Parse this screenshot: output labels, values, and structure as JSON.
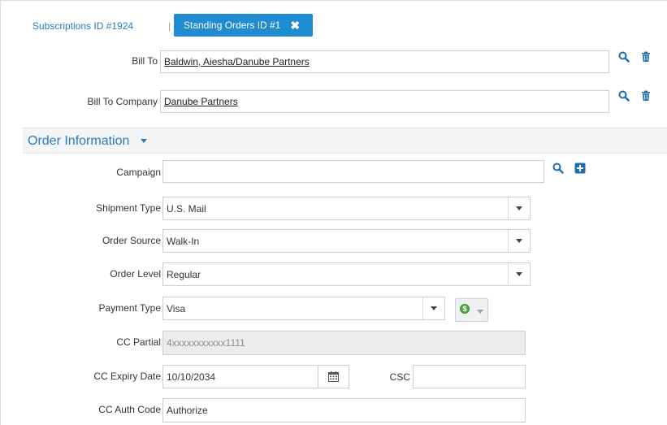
{
  "tabs": {
    "subscriptions": "Subscriptions ID #1924",
    "separator": "|",
    "standing_orders": "Standing Orders ID #1"
  },
  "bill_to": {
    "label": "Bill To",
    "value": "Baldwin, Aiesha/Danube Partners"
  },
  "bill_to_company": {
    "label": "Bill To Company",
    "value": "Danube Partners"
  },
  "order_information": {
    "title": "Order Information",
    "campaign": {
      "label": "Campaign",
      "value": ""
    },
    "shipment_type": {
      "label": "Shipment Type",
      "value": "U.S. Mail"
    },
    "order_source": {
      "label": "Order Source",
      "value": "Walk-In"
    },
    "order_level": {
      "label": "Order Level",
      "value": "Regular"
    },
    "payment_type": {
      "label": "Payment Type",
      "value": "Visa"
    },
    "cc_partial": {
      "label": "CC Partial",
      "value": "4xxxxxxxxxxx1111"
    },
    "cc_expiry": {
      "label": "CC Expiry Date",
      "value": "10/10/2034"
    },
    "csc": {
      "label": "CSC",
      "value": ""
    },
    "cc_auth_code": {
      "label": "CC Auth Code",
      "value": "Authorize"
    }
  },
  "icons": {
    "search": "search-icon",
    "delete": "trash-icon",
    "add": "plus-square-icon",
    "calendar": "calendar-icon",
    "payment": "dollar-coin-icon"
  },
  "colors": {
    "accent": "#1f8bd0",
    "link": "#2a7ab8",
    "section_bg": "#f3f5f7"
  }
}
